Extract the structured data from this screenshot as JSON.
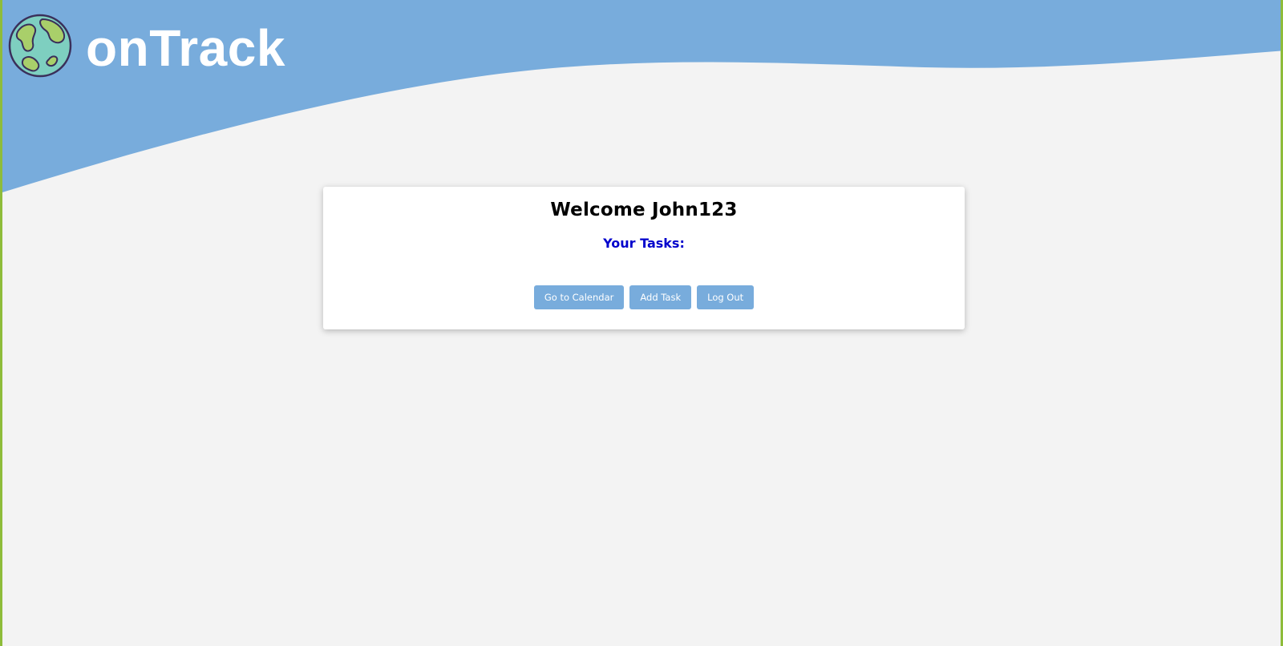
{
  "header": {
    "brand_name": "onTrack",
    "logo_icon": "globe-icon",
    "colors": {
      "header_blue": "#78acdc",
      "page_bg": "#f3f3f3",
      "side_border": "#8ebc3a"
    }
  },
  "card": {
    "welcome_text": "Welcome John123",
    "tasks_heading": "Your Tasks:",
    "tasks": [],
    "buttons": {
      "calendar_label": "Go to Calendar",
      "add_task_label": "Add Task",
      "logout_label": "Log Out"
    },
    "colors": {
      "button_bg": "#78acdc",
      "tasks_heading": "#0000cc"
    }
  }
}
